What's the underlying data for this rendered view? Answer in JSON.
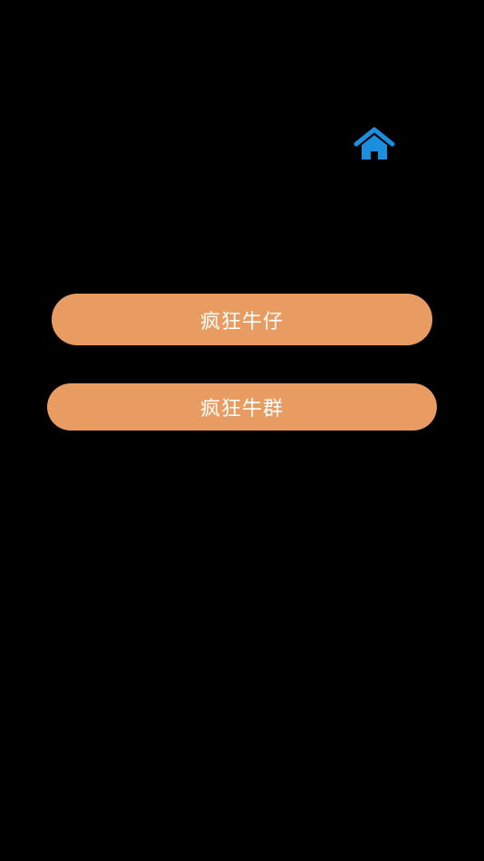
{
  "header": {
    "home_icon": "home-icon",
    "home_color": "#1a8fe0"
  },
  "menu": {
    "accent_color": "#e89c62",
    "items": [
      {
        "label": "疯狂牛仔"
      },
      {
        "label": "疯狂牛群"
      }
    ]
  }
}
